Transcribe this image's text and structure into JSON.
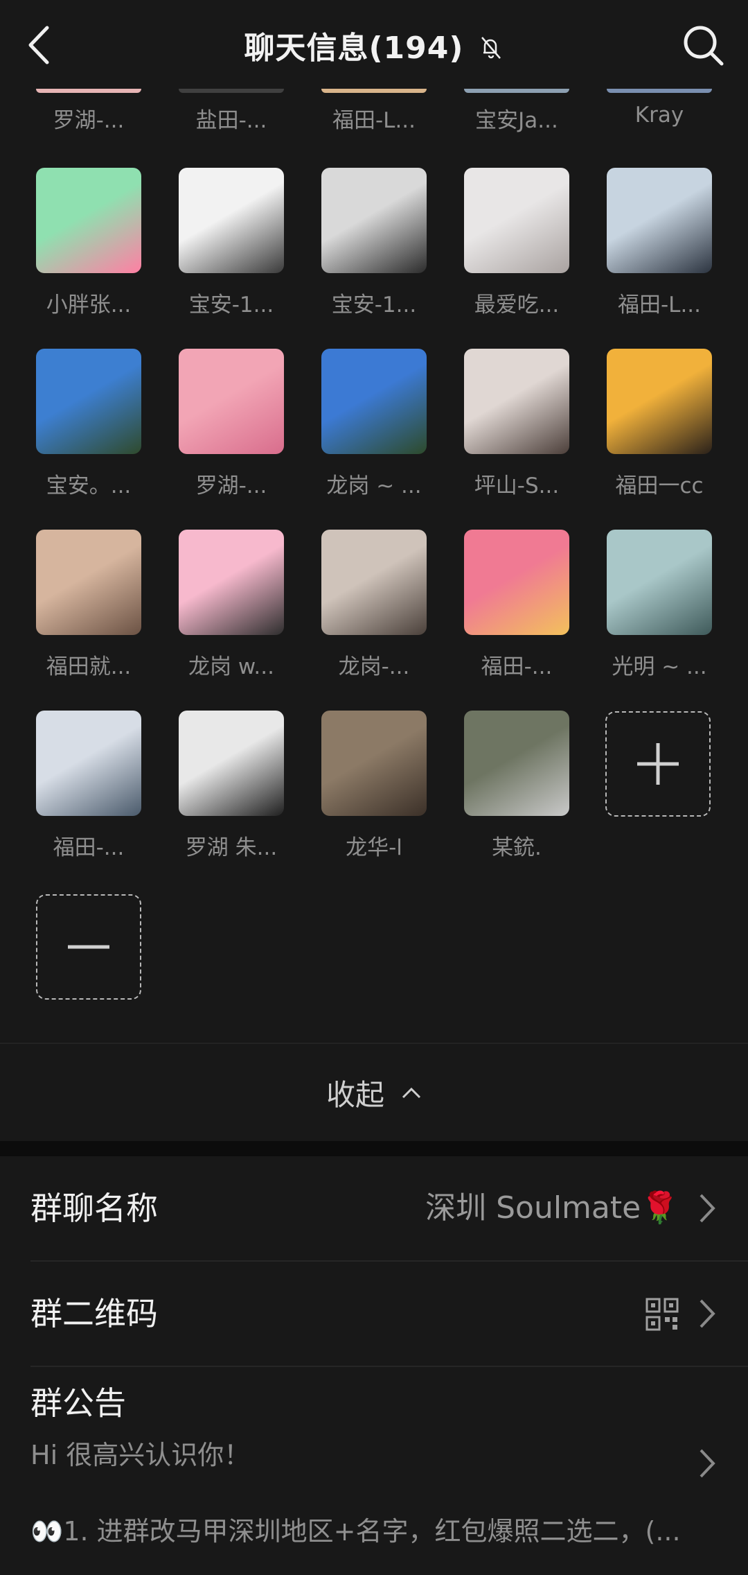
{
  "header": {
    "title": "聊天信息(194)",
    "back_icon": "chevron-left-icon",
    "mute_icon": "bell-off-icon",
    "search_icon": "search-icon"
  },
  "top_row": [
    "罗湖-...",
    "盐田-...",
    "福田-L...",
    "宝安Ja...",
    "Kray"
  ],
  "members": [
    {
      "name": "小胖张...",
      "colors": [
        "#8fe0b0",
        "#ff7fa3"
      ]
    },
    {
      "name": "宝安-1...",
      "colors": [
        "#f2f2f2",
        "#3a3a3a"
      ]
    },
    {
      "name": "宝安-1...",
      "colors": [
        "#d9d9d9",
        "#2b2b2b"
      ]
    },
    {
      "name": "最爱吃...",
      "colors": [
        "#e8e6e6",
        "#a9a2a0"
      ]
    },
    {
      "name": "福田-L...",
      "colors": [
        "#c7d4e0",
        "#2c3440"
      ]
    },
    {
      "name": "宝安。...",
      "colors": [
        "#3d7fd1",
        "#2f4a2c"
      ]
    },
    {
      "name": "罗湖-...",
      "colors": [
        "#f2a5b5",
        "#d86d8c"
      ]
    },
    {
      "name": "龙岗 ~ ...",
      "colors": [
        "#3c7ad4",
        "#2d4a2a"
      ]
    },
    {
      "name": "坪山-S...",
      "colors": [
        "#e0d7d3",
        "#4c3f3a"
      ]
    },
    {
      "name": "福田一cc",
      "colors": [
        "#f1b13b",
        "#2a211a"
      ]
    },
    {
      "name": "福田就...",
      "colors": [
        "#d6b59e",
        "#6b5244"
      ]
    },
    {
      "name": "龙岗 w...",
      "colors": [
        "#f7b9cd",
        "#2e2e2e"
      ]
    },
    {
      "name": "龙岗-...",
      "colors": [
        "#cfc3ba",
        "#4a403a"
      ]
    },
    {
      "name": "福田-...",
      "colors": [
        "#f07a93",
        "#f2c15c"
      ]
    },
    {
      "name": "光明 ~ ...",
      "colors": [
        "#a9c7c8",
        "#3f5a5a"
      ]
    },
    {
      "name": "福田-...",
      "colors": [
        "#d7dde6",
        "#4a5a6b"
      ]
    },
    {
      "name": "罗湖 朱...",
      "colors": [
        "#e8e8e8",
        "#1f1f1f"
      ]
    },
    {
      "name": "龙华-l",
      "colors": [
        "#8c7a66",
        "#3b3028"
      ]
    },
    {
      "name": "某銃.",
      "colors": [
        "#6e7562",
        "#c9c9c9"
      ]
    }
  ],
  "add_button_icon": "plus-icon",
  "remove_button_icon": "minus-icon",
  "collapse": {
    "label": "收起",
    "icon": "chevron-up-icon"
  },
  "settings": {
    "group_name": {
      "label": "群聊名称",
      "value": "深圳 Soulmate🌹"
    },
    "qr_code": {
      "label": "群二维码",
      "icon": "qr-code-icon"
    },
    "notice": {
      "label": "群公告",
      "line1": "Hi 很高兴认识你！",
      "line2": "👀1. 进群改马甲深圳地区+名字，红包爆照二选二，(..."
    }
  }
}
